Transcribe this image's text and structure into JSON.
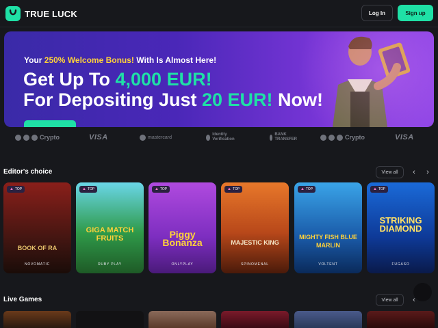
{
  "header": {
    "brand": "TRUE LUCK",
    "login_label": "Log In",
    "signup_label": "Sign up",
    "accent_color": "#1fe0a6"
  },
  "banner": {
    "sub_prefix": "Your ",
    "sub_accent": "250% Welcome Bonus!",
    "sub_suffix": " With Is Almost Here!",
    "line1_prefix": "Get Up To ",
    "line1_amount": "4,000 EUR!",
    "line2_prefix": "For Depositing Just ",
    "line2_amount": "20 EUR!",
    "line2_suffix": " Now!"
  },
  "payments": [
    {
      "label": "Crypto",
      "icon": "crypto-coins-icon"
    },
    {
      "label": "VISA",
      "icon": "visa-logo"
    },
    {
      "label": "mastercard",
      "icon": "mastercard-logo"
    },
    {
      "label": "Identity Verification",
      "icon": "identity-icon"
    },
    {
      "label": "BANK TRANSFER",
      "icon": "bank-icon"
    },
    {
      "label": "Crypto",
      "icon": "crypto-coins-icon"
    },
    {
      "label": "VISA",
      "icon": "visa-logo"
    }
  ],
  "editors_choice": {
    "title": "Editor's choice",
    "view_all": "View all",
    "games": [
      {
        "badge": "TOP",
        "title": "BOOK OF RA",
        "provider": "NOVOMATIC"
      },
      {
        "badge": "TOP",
        "title": "GIGA MATCH FRUITS",
        "provider": "RUBY PLAY"
      },
      {
        "badge": "TOP",
        "title": "Piggy Bonanza",
        "provider": "ONLYPLAY"
      },
      {
        "badge": "TOP",
        "title": "MAJESTIC KING",
        "provider": "SPINOMENAL"
      },
      {
        "badge": "TOP",
        "title": "MIGHTY FISH BLUE MARLIN",
        "provider": "VOLTENT"
      },
      {
        "badge": "TOP",
        "title": "STRIKING DIAMOND",
        "provider": "FUGASO"
      }
    ]
  },
  "live_games": {
    "title": "Live Games",
    "view_all": "View all"
  }
}
